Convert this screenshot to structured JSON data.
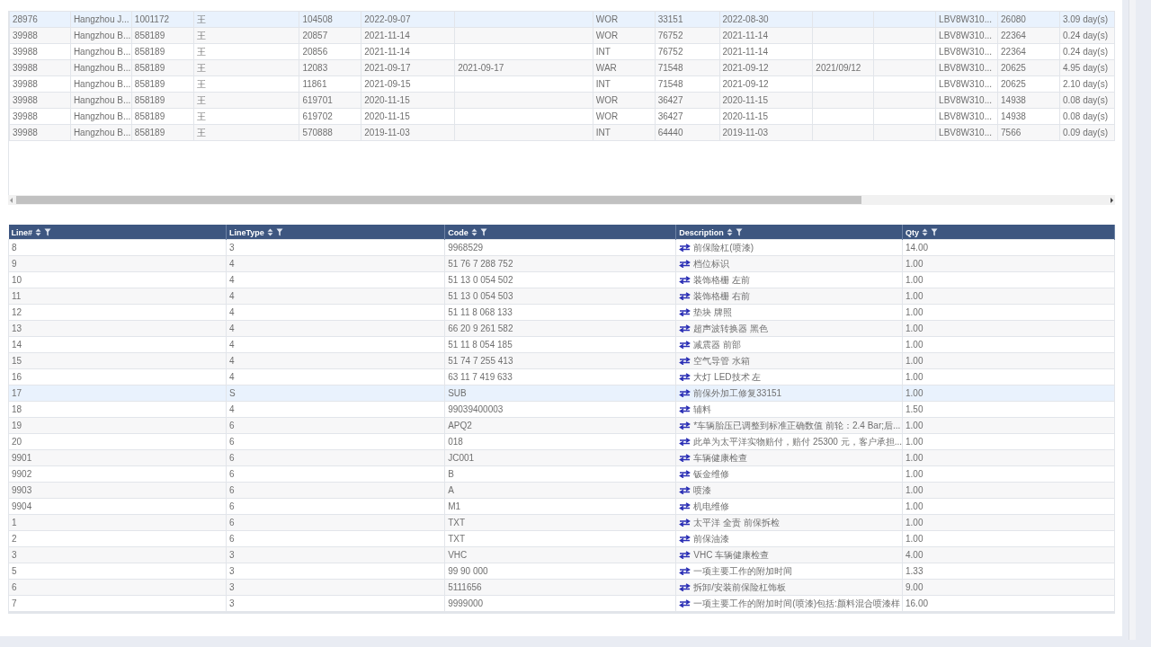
{
  "upper_table": {
    "rows": [
      {
        "selected": true,
        "cells": [
          "28976",
          "Hangzhou J...",
          "1001172",
          "王",
          "104508",
          "2022-09-07",
          "",
          "WOR",
          "33151",
          "2022-08-30",
          "",
          "",
          "LBV8W310...",
          "26080",
          "3.09 day(s)"
        ]
      },
      {
        "selected": false,
        "cells": [
          "39988",
          "Hangzhou B...",
          "858189",
          "王",
          "20857",
          "2021-11-14",
          "",
          "WOR",
          "76752",
          "2021-11-14",
          "",
          "",
          "LBV8W310...",
          "22364",
          "0.24 day(s)"
        ]
      },
      {
        "selected": false,
        "cells": [
          "39988",
          "Hangzhou B...",
          "858189",
          "王",
          "20856",
          "2021-11-14",
          "",
          "INT",
          "76752",
          "2021-11-14",
          "",
          "",
          "LBV8W310...",
          "22364",
          "0.24 day(s)"
        ]
      },
      {
        "selected": false,
        "cells": [
          "39988",
          "Hangzhou B...",
          "858189",
          "王",
          "12083",
          "2021-09-17",
          "2021-09-17",
          "WAR",
          "71548",
          "2021-09-12",
          "2021/09/12",
          "",
          "LBV8W310...",
          "20625",
          "4.95 day(s)"
        ]
      },
      {
        "selected": false,
        "cells": [
          "39988",
          "Hangzhou B...",
          "858189",
          "王",
          "11861",
          "2021-09-15",
          "",
          "INT",
          "71548",
          "2021-09-12",
          "",
          "",
          "LBV8W310...",
          "20625",
          "2.10 day(s)"
        ]
      },
      {
        "selected": false,
        "cells": [
          "39988",
          "Hangzhou B...",
          "858189",
          "王",
          "619701",
          "2020-11-15",
          "",
          "WOR",
          "36427",
          "2020-11-15",
          "",
          "",
          "LBV8W310...",
          "14938",
          "0.08 day(s)"
        ]
      },
      {
        "selected": false,
        "cells": [
          "39988",
          "Hangzhou B...",
          "858189",
          "王",
          "619702",
          "2020-11-15",
          "",
          "WOR",
          "36427",
          "2020-11-15",
          "",
          "",
          "LBV8W310...",
          "14938",
          "0.08 day(s)"
        ]
      },
      {
        "selected": false,
        "cells": [
          "39988",
          "Hangzhou B...",
          "858189",
          "王",
          "570888",
          "2019-11-03",
          "",
          "INT",
          "64440",
          "2019-11-03",
          "",
          "",
          "LBV8W310...",
          "7566",
          "0.09 day(s)"
        ]
      }
    ]
  },
  "lines_table": {
    "columns": [
      {
        "label": "Line#",
        "kind": "text"
      },
      {
        "label": "LineType",
        "kind": "text"
      },
      {
        "label": "Code",
        "kind": "text"
      },
      {
        "label": "Description",
        "kind": "linked"
      },
      {
        "label": "Qty",
        "kind": "text"
      }
    ],
    "rows": [
      {
        "selected": false,
        "cells": [
          "8",
          "3",
          "9968529",
          "前保险杠(喷漆)",
          "14.00"
        ]
      },
      {
        "selected": false,
        "cells": [
          "9",
          "4",
          "51 76 7 288 752",
          "档位标识",
          "1.00"
        ]
      },
      {
        "selected": false,
        "cells": [
          "10",
          "4",
          "51 13 0 054 502",
          "装饰格栅 左前",
          "1.00"
        ]
      },
      {
        "selected": false,
        "cells": [
          "11",
          "4",
          "51 13 0 054 503",
          "装饰格栅 右前",
          "1.00"
        ]
      },
      {
        "selected": false,
        "cells": [
          "12",
          "4",
          "51 11 8 068 133",
          "垫块 牌照",
          "1.00"
        ]
      },
      {
        "selected": false,
        "cells": [
          "13",
          "4",
          "66 20 9 261 582",
          "超声波转换器 黑色",
          "1.00"
        ]
      },
      {
        "selected": false,
        "cells": [
          "14",
          "4",
          "51 11 8 054 185",
          "减震器 前部",
          "1.00"
        ]
      },
      {
        "selected": false,
        "cells": [
          "15",
          "4",
          "51 74 7 255 413",
          "空气导管 水箱",
          "1.00"
        ]
      },
      {
        "selected": false,
        "cells": [
          "16",
          "4",
          "63 11 7 419 633",
          "大灯 LED技术 左",
          "1.00"
        ]
      },
      {
        "selected": true,
        "cells": [
          "17",
          "S",
          "SUB",
          "前保外加工修复33151",
          "1.00"
        ]
      },
      {
        "selected": false,
        "cells": [
          "18",
          "4",
          "99039400003",
          "辅料",
          "1.50"
        ]
      },
      {
        "selected": false,
        "cells": [
          "19",
          "6",
          "APQ2",
          "*车辆胎压已调整到标准正确数值 前轮：2.4 Bar;后...",
          "1.00"
        ]
      },
      {
        "selected": false,
        "cells": [
          "20",
          "6",
          "018",
          "此单为太平洋实物赔付，赔付 25300 元，客户承担...",
          "1.00"
        ]
      },
      {
        "selected": false,
        "cells": [
          "9901",
          "6",
          "JC001",
          "车辆健康检查",
          "1.00"
        ]
      },
      {
        "selected": false,
        "cells": [
          "9902",
          "6",
          "B",
          "钣金维修",
          "1.00"
        ]
      },
      {
        "selected": false,
        "cells": [
          "9903",
          "6",
          "A",
          "喷漆",
          "1.00"
        ]
      },
      {
        "selected": false,
        "cells": [
          "9904",
          "6",
          "M1",
          "机电维修",
          "1.00"
        ]
      },
      {
        "selected": false,
        "cells": [
          "1",
          "6",
          "TXT",
          "太平洋 全责 前保拆检",
          "1.00"
        ]
      },
      {
        "selected": false,
        "cells": [
          "2",
          "6",
          "TXT",
          "前保油漆",
          "1.00"
        ]
      },
      {
        "selected": false,
        "cells": [
          "3",
          "3",
          "VHC",
          "VHC 车辆健康检查",
          "4.00"
        ]
      },
      {
        "selected": false,
        "cells": [
          "5",
          "3",
          "99 90 000",
          "一项主要工作的附加时间",
          "1.33"
        ]
      },
      {
        "selected": false,
        "cells": [
          "6",
          "3",
          "5111656",
          "拆卸/安装前保险杠饰板",
          "9.00"
        ]
      },
      {
        "selected": false,
        "cells": [
          "7",
          "3",
          "9999000",
          "一项主要工作的附加时间(喷漆)包括:颜料混合喷漆样",
          "16.00"
        ]
      }
    ]
  }
}
